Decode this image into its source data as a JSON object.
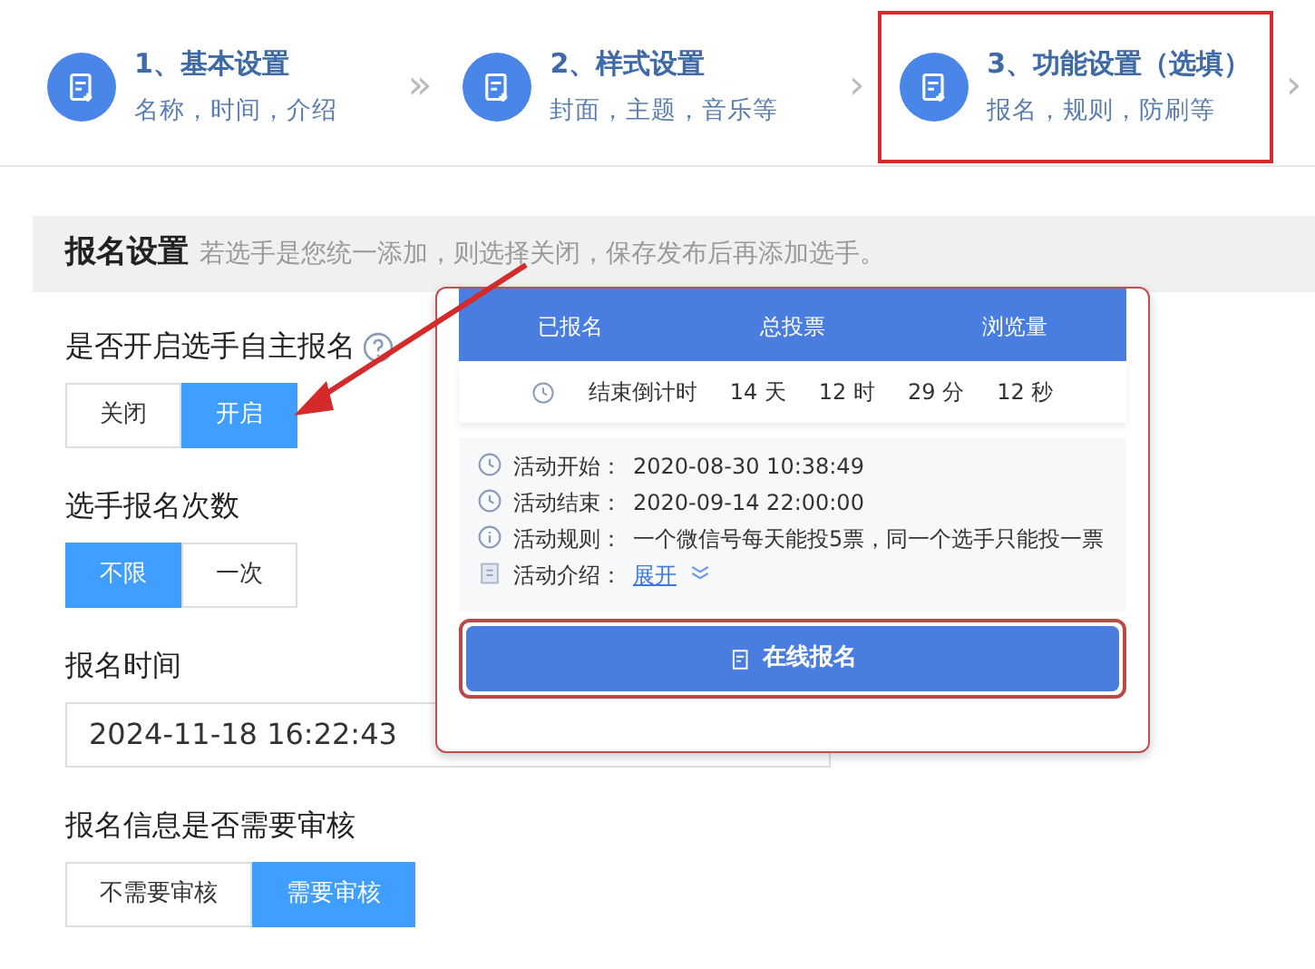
{
  "steps": [
    {
      "title": "1、基本设置",
      "subtitle": "名称，时间，介绍",
      "annotated": false,
      "arrow": "»"
    },
    {
      "title": "2、样式设置",
      "subtitle": "封面，主题，音乐等",
      "annotated": false,
      "arrow": "›"
    },
    {
      "title": "3、功能设置（选填）",
      "subtitle": "报名，规则，防刷等",
      "annotated": true,
      "arrow": "›"
    }
  ],
  "section": {
    "title": "报名设置",
    "hint": "若选手是您统一添加，则选择关闭，保存发布后再添加选手。"
  },
  "fields": [
    {
      "kind": "toggle",
      "label": "是否开启选手自主报名",
      "help": true,
      "options": [
        {
          "label": "关闭",
          "selected": false
        },
        {
          "label": "开启",
          "selected": true
        }
      ]
    },
    {
      "kind": "toggle",
      "label": "选手报名次数",
      "help": false,
      "options": [
        {
          "label": "不限",
          "selected": true
        },
        {
          "label": "一次",
          "selected": false
        }
      ]
    },
    {
      "kind": "date",
      "label": "报名时间",
      "help": false,
      "value": "2024-11-18 16:22:43"
    },
    {
      "kind": "toggle",
      "label": "报名信息是否需要审核",
      "help": false,
      "options": [
        {
          "label": "不需要审核",
          "selected": false
        },
        {
          "label": "需要审核",
          "selected": true
        }
      ]
    }
  ],
  "preview": {
    "stat_labels": [
      "已报名",
      "总投票",
      "浏览量"
    ],
    "countdown": {
      "label": "结束倒计时",
      "parts": [
        "14 天",
        "12 时",
        "29 分",
        "12 秒"
      ]
    },
    "details": [
      {
        "kind": "clock",
        "label": "活动开始：",
        "value": "2020-08-30   10:38:49"
      },
      {
        "kind": "clock",
        "label": "活动结束：",
        "value": "2020-09-14   22:00:00"
      },
      {
        "kind": "info",
        "label": "活动规则：",
        "value": "一个微信号每天能投5票，同一个选手只能投一票"
      },
      {
        "kind": "doc",
        "label": "活动介绍：",
        "link": "展开"
      }
    ],
    "button": "在线报名",
    "annotated": true
  }
}
